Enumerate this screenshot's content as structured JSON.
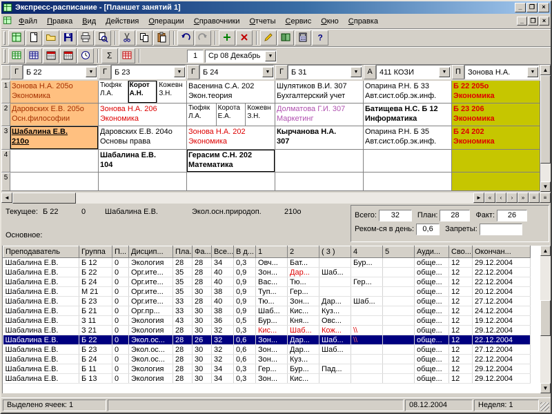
{
  "window": {
    "title": "Экспресс-расписание - [Планшет занятий 1]"
  },
  "menu": {
    "items": [
      {
        "key": "file",
        "label": "Файл"
      },
      {
        "key": "edit",
        "label": "Правка"
      },
      {
        "key": "view",
        "label": "Вид"
      },
      {
        "key": "actions",
        "label": "Действия"
      },
      {
        "key": "operations",
        "label": "Операции"
      },
      {
        "key": "references",
        "label": "Справочники"
      },
      {
        "key": "reports",
        "label": "Отчеты"
      },
      {
        "key": "service",
        "label": "Сервис"
      },
      {
        "key": "window",
        "label": "Окно"
      },
      {
        "key": "help",
        "label": "Справка"
      }
    ]
  },
  "toolbar_main": {
    "buttons": [
      {
        "key": "tablet",
        "icon": "tablet-icon"
      },
      {
        "key": "new",
        "icon": "new-icon"
      },
      {
        "key": "open",
        "icon": "open-icon"
      },
      {
        "key": "save",
        "icon": "save-icon"
      },
      {
        "key": "print",
        "icon": "print-icon"
      },
      {
        "key": "preview",
        "icon": "preview-icon"
      },
      "sep",
      {
        "key": "cut",
        "icon": "cut-icon"
      },
      {
        "key": "copy",
        "icon": "copy-icon"
      },
      {
        "key": "paste",
        "icon": "paste-icon"
      },
      "sep",
      {
        "key": "undo",
        "icon": "undo-icon"
      },
      {
        "key": "redo",
        "icon": "redo-icon"
      },
      "sep",
      {
        "key": "add-row",
        "icon": "add-icon"
      },
      {
        "key": "delete-row",
        "icon": "delete-icon"
      },
      "sep",
      {
        "key": "edit-cell",
        "icon": "pencil-icon"
      },
      {
        "key": "references",
        "icon": "book-icon"
      },
      {
        "key": "calculator",
        "icon": "calc-icon"
      },
      {
        "key": "help",
        "icon": "help-icon"
      }
    ]
  },
  "toolbar_date": {
    "buttons": [
      {
        "key": "tablet-view",
        "icon": "grid-green-icon"
      },
      {
        "key": "list-view",
        "icon": "grid-blue-icon"
      },
      {
        "key": "day-view",
        "icon": "calendar-icon"
      },
      {
        "key": "week-view",
        "icon": "calendar-icon"
      },
      {
        "key": "time-view",
        "icon": "clock-icon"
      },
      "sep",
      {
        "key": "sum",
        "icon": "sigma-icon"
      },
      {
        "key": "load",
        "icon": "grid-red-icon"
      },
      "sep"
    ],
    "lesson_number": "1",
    "date_value": "Ср 08 Декабрь"
  },
  "schedule": {
    "columns": [
      {
        "type": "Г",
        "value": "Б 22"
      },
      {
        "type": "Г",
        "value": "Б 23"
      },
      {
        "type": "Г",
        "value": "Б 24"
      },
      {
        "type": "Г",
        "value": "Б 31"
      },
      {
        "type": "А",
        "value": "411 КОЗИ"
      },
      {
        "type": "П",
        "value": "Зонова Н.А."
      }
    ],
    "row_numbers": [
      "1",
      "2",
      "3",
      "4",
      "5"
    ],
    "rows": [
      [
        {
          "l1": "Зонова Н.А.  205о",
          "l2": "Экономика",
          "bg": "orange",
          "fg": "maroon"
        },
        {
          "split": [
            {
              "l1": "Тюфяк",
              "l2": "Л.А."
            },
            {
              "l1": "Корот",
              "l2": "А.Н.",
              "bold": true,
              "frame": true
            },
            {
              "l1": "Кожевн",
              "l2": "З.Н."
            }
          ]
        },
        {
          "l1": "Васенина С.А.  202",
          "l2": "Экон.теория"
        },
        {
          "l1": "Шулятиков В.И.  307",
          "l2": "Бухгалтерский учет"
        },
        {
          "l1": "Опарина Р.Н. Б 33",
          "l2": "Авт.сист.обр.эк.инф."
        },
        {
          "l1": "Б 22  205о",
          "l2": "Экономика",
          "bg": "olive",
          "fg": "red",
          "bold": true
        }
      ],
      [
        {
          "l1": "Даровских Е.В.  205о",
          "l2": "Осн.философии",
          "bg": "orange",
          "fg": "maroon"
        },
        {
          "l1": "Зонова Н.А.  206",
          "l2": "Экономика",
          "fg": "red"
        },
        {
          "split": [
            {
              "l1": "Тюфяк",
              "l2": "Л.А."
            },
            {
              "l1": "Корота",
              "l2": "Е.А."
            },
            {
              "l1": "Кожевн",
              "l2": "З.Н."
            }
          ]
        },
        {
          "l1": "Долматова Г.И.  307",
          "l2": "Маркетинг",
          "fg": "violet"
        },
        {
          "l1": "Батищева Н.С. Б 12",
          "l2": "Информатика",
          "bold": true
        },
        {
          "l1": "Б 23  206",
          "l2": "Экономика",
          "bg": "olive",
          "fg": "red",
          "bold": true
        }
      ],
      [
        {
          "l1": "Шабалина Е.В.",
          "l2": "210о",
          "bg": "orange",
          "bold": true,
          "underline": true,
          "frame": true
        },
        {
          "l1": "Даровских Е.В.  204о",
          "l2": "Основы права"
        },
        {
          "l1": "Зонова Н.А.  202",
          "l2": "Экономика",
          "fg": "red"
        },
        {
          "l1": "Кырчанова Н.А.",
          "l2": "307",
          "bold": true
        },
        {
          "l1": "Опарина Р.Н. Б 35",
          "l2": "Авт.сист.обр.эк.инф."
        },
        {
          "l1": "Б 24  202",
          "l2": "Экономика",
          "bg": "olive",
          "fg": "red",
          "bold": true
        }
      ],
      [
        null,
        {
          "l1": "Шабалина Е.В.",
          "l2": "104",
          "bold": true
        },
        {
          "l1": "Герасим С.Н.  202",
          "l2": "Математика",
          "bold": true,
          "frame": true
        },
        null,
        null,
        {
          "bg": "olive"
        }
      ],
      [
        null,
        null,
        null,
        null,
        null,
        {
          "bg": "olive"
        }
      ]
    ]
  },
  "current": {
    "label": "Текущее:",
    "group": "Б 22",
    "subgroup": "0",
    "teacher": "Шабалина Е.В.",
    "discipline": "Экол.осн.природоп.",
    "room": "210о"
  },
  "stats": {
    "total_label": "Всего:",
    "total_value": "32",
    "plan_label": "План:",
    "plan_value": "28",
    "fact_label": "Факт:",
    "fact_value": "26",
    "per_day_label": "Реком-ся в день:",
    "per_day_value": "0,6",
    "bans_label": "Запреты:",
    "bans_value": ""
  },
  "main_section_label": "Основное:",
  "table": {
    "headers": [
      "Преподаватель",
      "Группа",
      "П...",
      "Дисцип...",
      "Пла...",
      "Фа...",
      "Все...",
      "В д...",
      "1",
      "2",
      "( 3 )",
      "4",
      "5",
      "Ауди...",
      "Сво...",
      "Окончан..."
    ],
    "selected_index": 8,
    "rows": [
      [
        "Шабалина Е.В.",
        "Б 12",
        "0",
        "Экология",
        "28",
        "28",
        "34",
        "0,3",
        "Овч...",
        "Бат...",
        "",
        "Бур...",
        "",
        "обще...",
        "12",
        "29.12.2004"
      ],
      [
        "Шабалина Е.В.",
        "Б 22",
        "0",
        "Орг.ите...",
        "35",
        "28",
        "40",
        "0,9",
        "Зон...",
        {
          "t": "Дар...",
          "red": true
        },
        "Шаб...",
        "",
        "",
        "обще...",
        "12",
        "22.12.2004"
      ],
      [
        "Шабалина Е.В.",
        "Б 24",
        "0",
        "Орг.ите...",
        "35",
        "28",
        "40",
        "0,9",
        "Вас...",
        "Тю...",
        "",
        "Гер...",
        "",
        "обще...",
        "12",
        "22.12.2004"
      ],
      [
        "Шабалина Е.В.",
        "М 21",
        "0",
        "Орг.ите...",
        "35",
        "30",
        "38",
        "0,9",
        "Туп...",
        "Гер...",
        "",
        "",
        "",
        "обще...",
        "12",
        "20.12.2004"
      ],
      [
        "Шабалина Е.В.",
        "Б 23",
        "0",
        "Орг.ите...",
        "33",
        "28",
        "40",
        "0,9",
        "Тю...",
        "Зон...",
        "Дар...",
        "Шаб...",
        "",
        "обще...",
        "12",
        "27.12.2004"
      ],
      [
        "Шабалина Е.В.",
        "Б 21",
        "0",
        "Орг.пр...",
        "33",
        "30",
        "38",
        "0,9",
        "Шаб...",
        "Кис...",
        "Куз...",
        "",
        "",
        "обще...",
        "12",
        "24.12.2004"
      ],
      [
        "Шабалина Е.В.",
        "З 11",
        "0",
        "Экология",
        "43",
        "30",
        "36",
        "0,5",
        "Бур...",
        "Кня...",
        "Овс...",
        "",
        "",
        "обще...",
        "12",
        "19.12.2004"
      ],
      [
        "Шабалина Е.В.",
        "З 21",
        "0",
        "Экология",
        "28",
        "30",
        "32",
        "0,3",
        {
          "t": "Кис...",
          "red": true
        },
        {
          "t": "Шаб...",
          "red": true
        },
        {
          "t": "Кож...",
          "red": true
        },
        {
          "t": "\\\\",
          "red": true
        },
        "",
        "обще...",
        "12",
        "29.12.2004"
      ],
      [
        "Шабалина Е.В.",
        "Б 22",
        "0",
        "Экол.ос...",
        "28",
        "26",
        "32",
        "0,6",
        "Зон...",
        "Дар...",
        "Шаб...",
        {
          "t": "\\\\",
          "red": true
        },
        "",
        "обще...",
        "12",
        "22.12.2004"
      ],
      [
        "Шабалина Е.В.",
        "Б 23",
        "0",
        "Экол.ос...",
        "28",
        "30",
        "32",
        "0,6",
        "Зон...",
        "Дар...",
        "Шаб...",
        "",
        "",
        "обще...",
        "12",
        "27.12.2004"
      ],
      [
        "Шабалина Е.В.",
        "Б 24",
        "0",
        "Экол.ос...",
        "28",
        "30",
        "32",
        "0,6",
        "Зон...",
        "Куз...",
        "",
        "",
        "",
        "обще...",
        "12",
        "22.12.2004"
      ],
      [
        "Шабалина Е.В.",
        "Б 11",
        "0",
        "Экология",
        "28",
        "30",
        "34",
        "0,3",
        "Гер...",
        "Бур...",
        "Пад...",
        "",
        "",
        "обще...",
        "12",
        "29.12.2004"
      ],
      [
        "Шабалина Е.В.",
        "Б 13",
        "0",
        "Экология",
        "28",
        "30",
        "34",
        "0,3",
        "Зон...",
        "Кис...",
        "",
        "",
        "",
        "обще...",
        "12",
        "29.12.2004"
      ]
    ]
  },
  "statusbar": {
    "selection": "Выделено ячеек: 1",
    "middle": "",
    "date": "08.12.2004",
    "week": "Неделя: 1"
  }
}
